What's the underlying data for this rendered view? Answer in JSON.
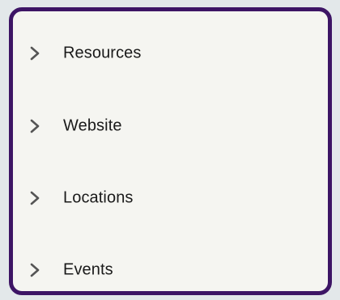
{
  "menu": {
    "items": [
      {
        "label": "Resources",
        "icon": "chevron-right-icon",
        "expanded": false
      },
      {
        "label": "Website",
        "icon": "chevron-right-icon",
        "expanded": false
      },
      {
        "label": "Locations",
        "icon": "chevron-right-icon",
        "expanded": false
      },
      {
        "label": "Events",
        "icon": "chevron-right-icon",
        "expanded": false
      }
    ]
  },
  "colors": {
    "background": "#e3e8ea",
    "panel": "#f5f5f1",
    "border": "#3d1565",
    "text": "#1a1a1a",
    "chevron": "#555555"
  }
}
